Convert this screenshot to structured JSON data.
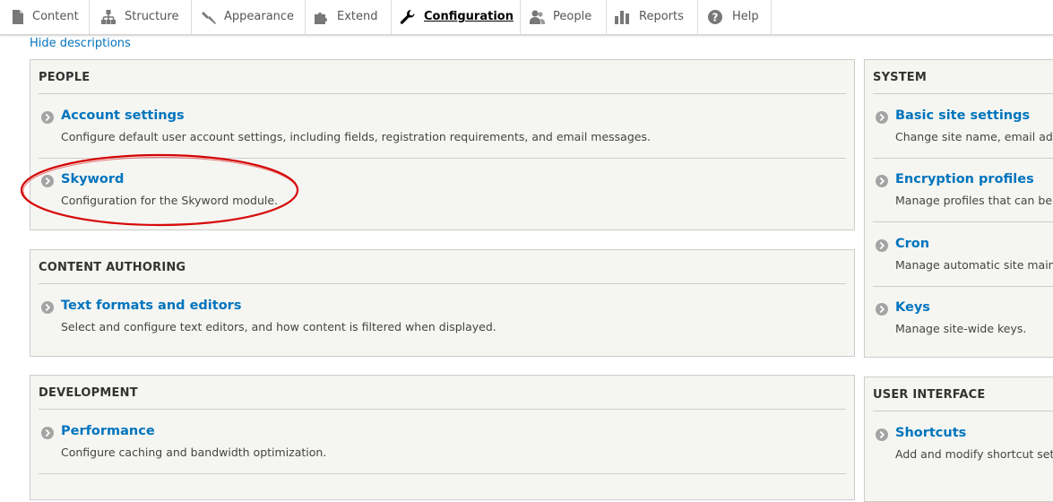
{
  "toolbar": {
    "tabs": [
      {
        "label": "Content",
        "icon": "document-icon"
      },
      {
        "label": "Structure",
        "icon": "hierarchy-icon"
      },
      {
        "label": "Appearance",
        "icon": "paintbrush-icon"
      },
      {
        "label": "Extend",
        "icon": "puzzle-icon"
      },
      {
        "label": "Configuration",
        "icon": "wrench-icon",
        "active": true
      },
      {
        "label": "People",
        "icon": "people-icon"
      },
      {
        "label": "Reports",
        "icon": "bar-chart-icon"
      },
      {
        "label": "Help",
        "icon": "question-icon"
      }
    ]
  },
  "main": {
    "hide_descriptions": "Hide descriptions",
    "people": {
      "title": "PEOPLE",
      "items": [
        {
          "label": "Account settings",
          "desc": "Configure default user account settings, including fields, registration requirements, and email messages."
        },
        {
          "label": "Skyword",
          "desc": "Configuration for the Skyword module."
        }
      ]
    },
    "content_authoring": {
      "title": "CONTENT AUTHORING",
      "items": [
        {
          "label": "Text formats and editors",
          "desc": "Select and configure text editors, and how content is filtered when displayed."
        }
      ]
    },
    "development": {
      "title": "DEVELOPMENT",
      "items": [
        {
          "label": "Performance",
          "desc": "Configure caching and bandwidth optimization."
        }
      ]
    },
    "system": {
      "title": "SYSTEM",
      "items": [
        {
          "label": "Basic site settings",
          "desc": "Change site name, email add"
        },
        {
          "label": "Encryption profiles",
          "desc": "Manage profiles that can be"
        },
        {
          "label": "Cron",
          "desc": "Manage automatic site main"
        },
        {
          "label": "Keys",
          "desc": "Manage site-wide keys."
        }
      ]
    },
    "user_interface": {
      "title": "USER INTERFACE",
      "items": [
        {
          "label": "Shortcuts",
          "desc": "Add and modify shortcut set"
        }
      ]
    }
  },
  "colors": {
    "link": "#0074bd",
    "panel_bg": "#f5f5f2",
    "annotation": "#d40000"
  }
}
